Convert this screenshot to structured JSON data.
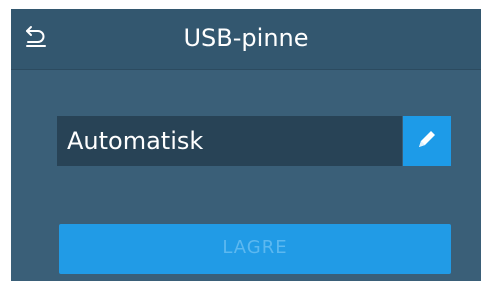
{
  "header": {
    "title": "USB-pinne",
    "back_icon": "back-arrow-icon"
  },
  "field": {
    "value": "Automatisk",
    "edit_icon": "pencil-icon"
  },
  "actions": {
    "save_label": "LAGRE",
    "save_enabled": false
  },
  "colors": {
    "background": "#33576f",
    "field_background": "#284356",
    "accent": "#1d9be8"
  }
}
